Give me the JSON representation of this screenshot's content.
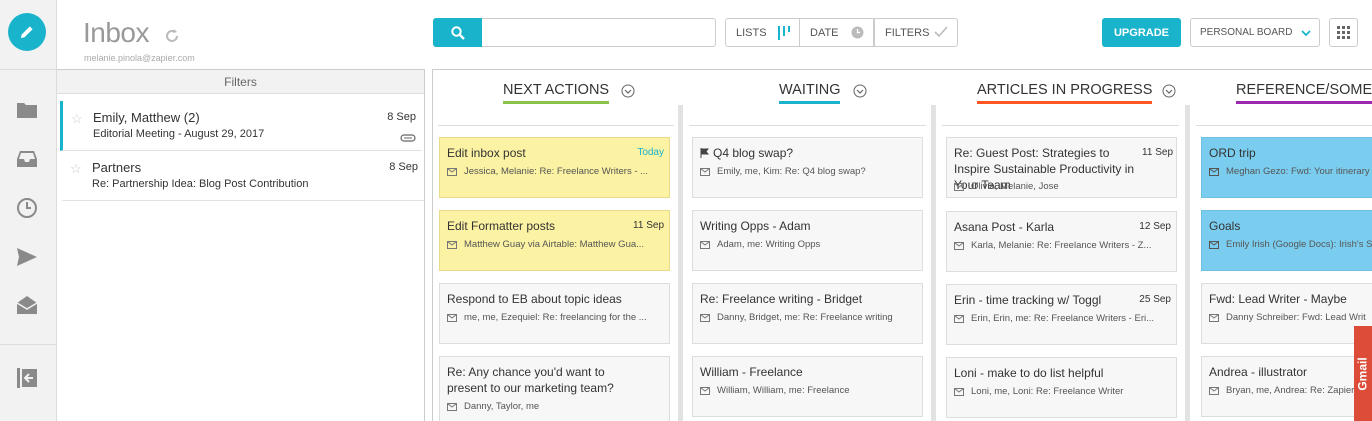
{
  "header": {
    "title": "Inbox",
    "account_email": "melanie.pinola@zapier.com",
    "search_placeholder": "",
    "view_lists": "LISTS",
    "view_date": "DATE",
    "view_filters": "FILTERS",
    "upgrade_label": "UPGRADE",
    "board_select": "PERSONAL BOARD"
  },
  "mail_list": {
    "filters_label": "Filters",
    "items": [
      {
        "sender": "Emily, Matthew (2)",
        "subject": "Editorial Meeting - August 29, 2017",
        "date": "8 Sep",
        "attachment": true
      },
      {
        "sender": "Partners",
        "subject": "Re: Partnership Idea: Blog Post Contribution",
        "date": "8 Sep",
        "attachment": false
      }
    ]
  },
  "columns": [
    {
      "title": "NEXT ACTIONS",
      "underline": "#8bc34a",
      "cards": [
        {
          "title": "Edit inbox post",
          "date": "Today",
          "snippet": "Jessica, Melanie: Re: Freelance Writers - ...",
          "color": "yellow"
        },
        {
          "title": "Edit Formatter posts",
          "date": "11 Sep",
          "snippet": "Matthew Guay via Airtable: Matthew Gua...",
          "color": "yellow"
        },
        {
          "title": "Respond to EB about topic ideas",
          "date": "",
          "snippet": "me, me, Ezequiel: Re: freelancing for the ...",
          "color": "gray"
        },
        {
          "title": "Re: Any chance you'd want to present to our marketing team?",
          "date": "",
          "snippet": "Danny, Taylor, me",
          "color": "gray"
        }
      ]
    },
    {
      "title": "WAITING",
      "underline": "#1ab3cc",
      "cards": [
        {
          "title": "Q4 blog swap?",
          "date": "",
          "snippet": "Emily, me, Kim: Re: Q4 blog swap?",
          "color": "gray",
          "flag": true
        },
        {
          "title": "Writing Opps - Adam",
          "date": "",
          "snippet": "Adam, me: Writing Opps",
          "color": "gray"
        },
        {
          "title": "Re: Freelance writing - Bridget",
          "date": "",
          "snippet": "Danny, Bridget, me: Re: Freelance writing",
          "color": "gray"
        },
        {
          "title": "William - Freelance",
          "date": "",
          "snippet": "William, William, me: Freelance",
          "color": "gray"
        }
      ]
    },
    {
      "title": "ARTICLES IN PROGRESS",
      "underline": "#ff5722",
      "cards": [
        {
          "title": "Re: Guest Post: Strategies to Inspire Sustainable Productivity in Your Team",
          "date": "11 Sep",
          "snippet": "Olivia, Melanie, Jose",
          "color": "gray"
        },
        {
          "title": "Asana Post - Karla",
          "date": "12 Sep",
          "snippet": "Karla, Melanie: Re: Freelance Writers - Z...",
          "color": "gray"
        },
        {
          "title": "Erin - time tracking w/ Toggl",
          "date": "25 Sep",
          "snippet": "Erin, Erin, me: Re: Freelance Writers - Eri...",
          "color": "gray"
        },
        {
          "title": "Loni - make to do list helpful",
          "date": "",
          "snippet": "Loni, me, Loni: Re: Freelance Writer",
          "color": "gray"
        }
      ]
    },
    {
      "title": "REFERENCE/SOME",
      "underline": "#9c27b0",
      "cards": [
        {
          "title": "ORD trip",
          "date": "",
          "snippet": "Meghan Gezo: Fwd: Your itinerary",
          "color": "blue"
        },
        {
          "title": "Goals",
          "date": "",
          "snippet": "Emily Irish (Google Docs): Irish's S",
          "color": "blue"
        },
        {
          "title": "Fwd: Lead Writer - Maybe",
          "date": "",
          "snippet": "Danny Schreiber: Fwd: Lead Writ",
          "color": "gray"
        },
        {
          "title": "Andrea - illustrator",
          "date": "",
          "snippet": "Bryan, me, Andrea: Re: Zapier",
          "color": "gray"
        }
      ]
    }
  ],
  "gmail_tab": "Gmail",
  "colors": {
    "accent": "#1ab3cc",
    "yellow_card": "#fbf2a3",
    "blue_card": "#7bcdef",
    "gmail_red": "#dd4b39"
  }
}
